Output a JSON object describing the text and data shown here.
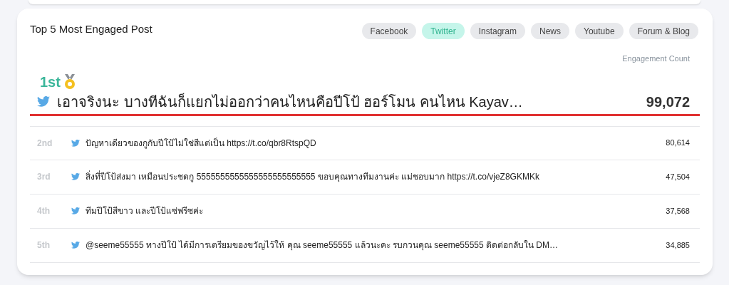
{
  "title": "Top 5 Most Engaged Post",
  "tabs": [
    {
      "label": "Facebook",
      "selected": false
    },
    {
      "label": "Twitter",
      "selected": true
    },
    {
      "label": "Instagram",
      "selected": false
    },
    {
      "label": "News",
      "selected": false
    },
    {
      "label": "Youtube",
      "selected": false
    },
    {
      "label": "Forum & Blog",
      "selected": false
    }
  ],
  "column_header": "Engagement Count",
  "top_post": {
    "rank": "1st",
    "text": "เอาจริงนะ บางทีฉันก็แยกไม่ออกว่าคนไหนคือปีโป้ ฮอร์โมน คนไหน Kayav…",
    "count": "99,072"
  },
  "posts": [
    {
      "rank": "2nd",
      "text": "ปัญหาเดียวของกูกับปีโป้ไม่ใช่สีแต่เป็น https://t.co/qbr8RtspQD",
      "count": "80,614"
    },
    {
      "rank": "3rd",
      "text": "สิ่งที่ปีโป้ส่งมา เหมือนประชดกู 5555555555555555555555555 ขอบคุณทางทีมงานค่ะ แม่ชอบมาก https://t.co/vjeZ8GKMKk",
      "count": "47,504"
    },
    {
      "rank": "4th",
      "text": "ทีมปีโป้สีขาว และปีโป้แซ่ฟรีซค่ะ",
      "count": "37,568"
    },
    {
      "rank": "5th",
      "text": "@seeme55555 ทางปีโป้ ได้มีการเตรียมของขวัญไว้ให้ คุณ seeme55555 แล้วนะคะ รบกวนคุณ seeme55555 ติดต่อกลับใน DM…",
      "count": "34,885"
    }
  ]
}
